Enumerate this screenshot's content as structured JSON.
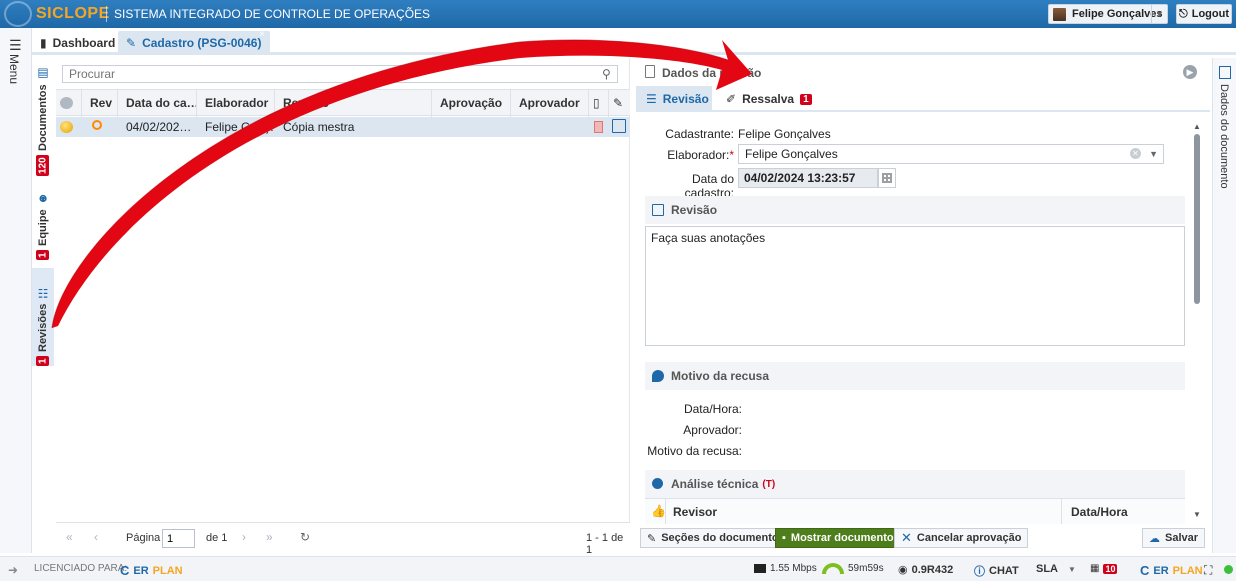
{
  "app": {
    "logo": "SICLOPE",
    "subtitle": "SISTEMA INTEGRADO DE CONTROLE DE OPERAÇÕES",
    "user": "Felipe Gonçalves",
    "logout": "Logout"
  },
  "rail": {
    "menu_label": "Menu",
    "tabs": [
      {
        "label": "Documentos",
        "badge": "120"
      },
      {
        "label": "Equipe",
        "badge": "1"
      },
      {
        "label": "Revisões",
        "badge": "1"
      }
    ]
  },
  "tabs": {
    "dashboard": "Dashboard",
    "cadastro": "Cadastro (PSG-0046)",
    "close": "×"
  },
  "search": {
    "placeholder": "Procurar"
  },
  "grid": {
    "columns": [
      "Rev",
      "Data do ca…",
      "Elaborador",
      "Revisão",
      "Aprovação",
      "Aprovador"
    ],
    "row": {
      "date": "04/02/202…",
      "elaborador": "Felipe Gonç…",
      "revisao": "Cópia mestra"
    }
  },
  "pager": {
    "page_label": "Página",
    "page_value": "1",
    "of_label": "de 1",
    "count": "1 - 1 de 1"
  },
  "right": {
    "title": "Dados da revisão",
    "tab_revisao": "Revisão",
    "tab_ressalva": "Ressalva",
    "ressalva_badge": "1",
    "cadastrante_label": "Cadastrante:",
    "cadastrante_value": "Felipe Gonçalves",
    "elaborador_label": "Elaborador:",
    "required_mark": "*",
    "elaborador_value": "Felipe Gonçalves",
    "data_label": "Data do cadastro:",
    "data_value": "04/02/2024 13:23:57",
    "revisao_section": "Revisão",
    "revisao_text": "Faça suas anotações",
    "motivo_section": "Motivo da recusa",
    "datahora_label": "Data/Hora:",
    "aprovador_label": "Aprovador:",
    "motivo_label": "Motivo da recusa:",
    "analise_section": "Análise técnica",
    "analise_mark": "(T)",
    "revisor_col": "Revisor",
    "datahora_col": "Data/Hora"
  },
  "footer": {
    "secoes": "Seções do documento",
    "mostrar": "Mostrar documento",
    "cancelar": "Cancelar aprovação",
    "salvar": "Salvar"
  },
  "right_rail": {
    "label": "Dados do documento"
  },
  "status": {
    "licenciado": "LICENCIADO PARA:",
    "erplan_a": "ER",
    "erplan_b": "PLAN",
    "speed": "1.55 Mbps",
    "time": "59m59s",
    "version": "0.9R432",
    "chat": "CHAT",
    "sla": "SLA",
    "notif_badge": "10"
  },
  "colors": {
    "header_blue": "#1f68a8",
    "logo_orange": "#f5a623",
    "badge_red": "#d0021b",
    "button_green": "#4e7d1b",
    "annotation_red": "#e30613"
  }
}
